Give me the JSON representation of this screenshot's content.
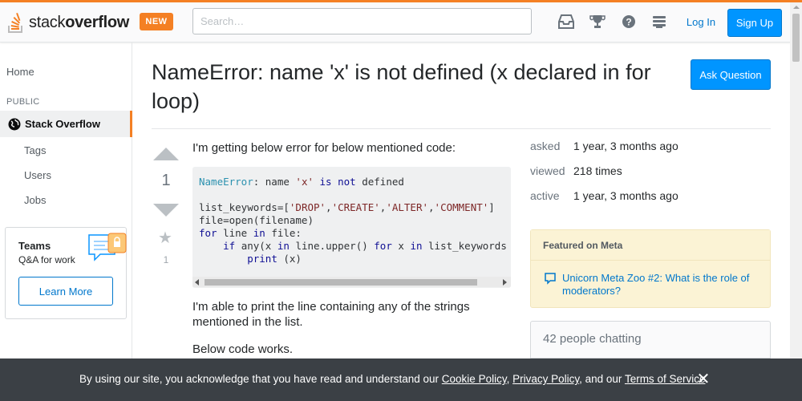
{
  "header": {
    "logo_text_light": "stack",
    "logo_text_bold": "overflow",
    "new_badge": "NEW",
    "search_placeholder": "Search…",
    "icons": [
      "inbox-icon",
      "achievements-icon",
      "help-icon",
      "site-switcher-icon"
    ],
    "login_label": "Log In",
    "signup_label": "Sign Up"
  },
  "sidebar": {
    "home": "Home",
    "public_heading": "PUBLIC",
    "stack_overflow": "Stack Overflow",
    "tags": "Tags",
    "users": "Users",
    "jobs": "Jobs",
    "teams_title": "Teams",
    "teams_subtitle": "Q&A for work",
    "learn_more": "Learn More"
  },
  "question": {
    "title": "NameError: name 'x' is not defined (x declared in for loop)",
    "ask_button": "Ask Question",
    "vote_count": "1",
    "favorite_count": "1",
    "intro": "I'm getting below error for below mentioned code:",
    "code_lines": [
      "NameError: name 'x' is not defined",
      "",
      "list_keywords=['DROP','CREATE','ALTER','COMMENT']",
      "file=open(filename)",
      "for line in file:",
      "    if any(x in line.upper() for x in list_keywords",
      "        print (x)"
    ],
    "para2": "I'm able to print the line containing any of the strings mentioned in the list.",
    "para3": "Below code works."
  },
  "stats": {
    "asked_label": "asked",
    "asked_value": "1 year, 3 months ago",
    "viewed_label": "viewed",
    "viewed_value": "218 times",
    "active_label": "active",
    "active_value": "1 year, 3 months ago"
  },
  "featured": {
    "heading": "Featured on Meta",
    "item": "Unicorn Meta Zoo #2: What is the role of moderators?"
  },
  "chat": {
    "title": "42 people chatting"
  },
  "cookie": {
    "prefix": "By using our site, you acknowledge that you have read and understand our ",
    "cookie_policy": "Cookie Policy",
    "sep1": ", ",
    "privacy_policy": "Privacy Policy",
    "sep2": ", and our ",
    "terms": "Terms of Service",
    "suffix": ".",
    "close": "✕"
  },
  "colors": {
    "accent_orange": "#f48024",
    "link_blue": "#0077cc",
    "button_blue": "#0095ff",
    "featured_bg": "#fbf3d5",
    "banner_bg": "#3b4045"
  }
}
